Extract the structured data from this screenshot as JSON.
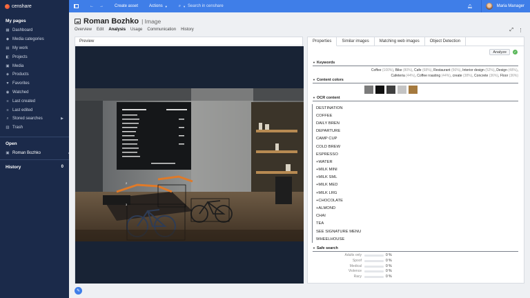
{
  "app": {
    "brand": "censhare"
  },
  "topbar": {
    "create_asset": "Create asset",
    "actions": "Actions",
    "search_placeholder": "Search in censhare",
    "user": "Maria Manager"
  },
  "sidebar": {
    "my_pages_title": "My pages",
    "items": [
      {
        "label": "Dashboard",
        "icon": "dashboard-icon"
      },
      {
        "label": "Media categories",
        "icon": "tag-icon"
      },
      {
        "label": "My work",
        "icon": "folder-icon"
      },
      {
        "label": "Projects",
        "icon": "projects-icon"
      },
      {
        "label": "Media",
        "icon": "image-icon"
      },
      {
        "label": "Products",
        "icon": "product-icon"
      },
      {
        "label": "Favorites",
        "icon": "heart-icon"
      },
      {
        "label": "Watched",
        "icon": "eye-icon"
      },
      {
        "label": "Last created",
        "icon": "list-icon"
      },
      {
        "label": "Last edited",
        "icon": "list-icon"
      },
      {
        "label": "Stored searches",
        "icon": "search-icon"
      },
      {
        "label": "Trash",
        "icon": "trash-icon"
      }
    ],
    "open_title": "Open",
    "open_item": "Roman Bozhko",
    "history_title": "History",
    "history_count": "0"
  },
  "header": {
    "title": "Roman Bozhko",
    "subtitle": "| Image",
    "tabs": [
      "Overview",
      "Edit",
      "Analysis",
      "Usage",
      "Communication",
      "History"
    ],
    "active_tab": "Analysis"
  },
  "preview": {
    "label": "Preview"
  },
  "panel": {
    "tabs": [
      "Properties",
      "Similar images",
      "Matching web images",
      "Object Detection"
    ],
    "analyze_label": "Analyze",
    "keywords_title": "Keywords",
    "keywords": [
      {
        "name": "Coffee",
        "pct": "(100%)"
      },
      {
        "name": "Bike",
        "pct": "(80%)"
      },
      {
        "name": "Cafe",
        "pct": "(68%)"
      },
      {
        "name": "Restaurant",
        "pct": "(56%)"
      },
      {
        "name": "Interior design",
        "pct": "(52%)"
      },
      {
        "name": "Design",
        "pct": "(48%)"
      },
      {
        "name": "Cafeteria",
        "pct": "(44%)"
      },
      {
        "name": "Coffee roasting",
        "pct": "(44%)"
      },
      {
        "name": "create",
        "pct": "(38%)"
      },
      {
        "name": "Concrete",
        "pct": "(36%)"
      },
      {
        "name": "Floor",
        "pct": "(36%)"
      }
    ],
    "colors_title": "Content colors",
    "colors": [
      "#7b7b7b",
      "#0f0f0f",
      "#404040",
      "#c4c4c4",
      "#a57a3e"
    ],
    "ocr_title": "OCR content",
    "ocr": [
      "DESTINATION",
      "COFFEE",
      "DAILY BREN",
      "DEPARTURE",
      "CAMP CUP",
      "COLD BREW",
      "ESPRESSO",
      "+WATER",
      "+MILK MINI",
      "+MILK SML",
      "+MILK MED",
      "+MILK LRG",
      "+CHOCOLATE",
      "+ALMOND",
      "CHAI",
      "TEA",
      "SEE SIGNATURE MENU",
      "WHEELHOUSE"
    ],
    "safe_title": "Safe search",
    "safe": [
      {
        "label": "Adults only",
        "value": "0 %"
      },
      {
        "label": "Spoof",
        "value": "0 %"
      },
      {
        "label": "Medical",
        "value": "0 %"
      },
      {
        "label": "Violence",
        "value": "0 %"
      },
      {
        "label": "Racy",
        "value": "0 %"
      }
    ]
  }
}
